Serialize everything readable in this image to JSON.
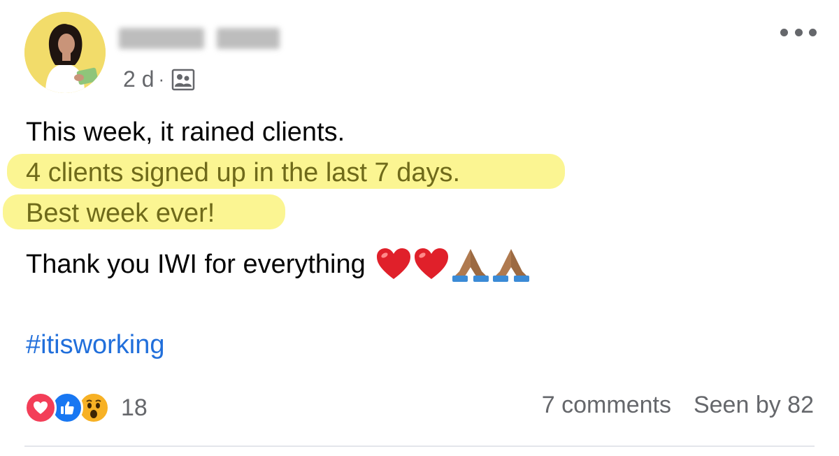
{
  "post": {
    "author_name": "",
    "timestamp": "2 d",
    "separator": "·",
    "audience_icon": "group-icon",
    "more_icon": "more-horizontal-icon",
    "lines": [
      "This week, it rained clients.",
      "4 clients signed up in the last 7 days.",
      "Best week ever!",
      "Thank you IWI for everything"
    ],
    "emojis": [
      "red-heart",
      "red-heart",
      "folded-hands",
      "folded-hands"
    ],
    "hashtag": "#itisworking",
    "highlight_color": "#fbf592",
    "highlight_text_color": "#6f6a1a"
  },
  "footer": {
    "reactions": [
      "love",
      "like",
      "wow"
    ],
    "reaction_count": "18",
    "comments": "7 comments",
    "seen_by": "Seen by 82"
  },
  "colors": {
    "link": "#216fdb",
    "muted": "#65676b",
    "love": "#f33e58",
    "like": "#1877f2",
    "wow": "#f7b125"
  }
}
